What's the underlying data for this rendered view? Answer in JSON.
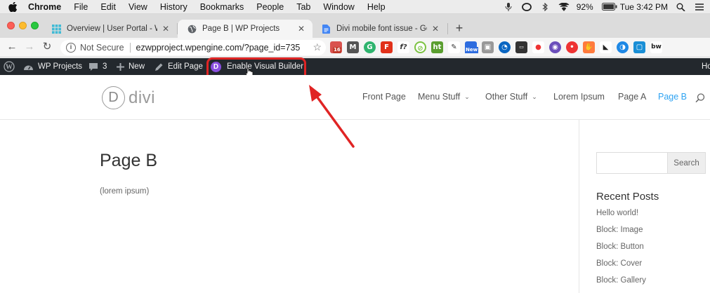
{
  "macos_menubar": {
    "app": "Chrome",
    "menus": [
      "File",
      "Edit",
      "View",
      "History",
      "Bookmarks",
      "People",
      "Tab",
      "Window",
      "Help"
    ],
    "battery": "92%",
    "clock": "Tue 3:42 PM"
  },
  "browser": {
    "tabs": [
      {
        "title": "Overview | User Portal - WP Engine",
        "favicon": "grid-icon",
        "active": false
      },
      {
        "title": "Page B | WP Projects",
        "favicon": "globe-icon",
        "active": true
      },
      {
        "title": "Divi mobile font issue - Google Docs",
        "favicon": "docs-icon",
        "active": false
      }
    ],
    "security_label": "Not Secure",
    "url": "ezwpproject.wpengine.com/?page_id=735",
    "extension_badges": {
      "ext1": "16",
      "ext6": "New"
    }
  },
  "wp_admin_bar": {
    "site_name": "WP Projects",
    "comments_count": "3",
    "new_label": "New",
    "edit_page_label": "Edit Page",
    "visual_builder_badge": "D",
    "visual_builder_label": "Enable Visual Builder",
    "howdy_truncated": "Ho"
  },
  "site_header": {
    "logo_letter": "D",
    "logo_word": "divi",
    "nav": [
      {
        "label": "Front Page",
        "has_submenu": false,
        "current": false
      },
      {
        "label": "Menu Stuff",
        "has_submenu": true,
        "current": false
      },
      {
        "label": "Other Stuff",
        "has_submenu": true,
        "current": false
      },
      {
        "label": "Lorem Ipsum",
        "has_submenu": false,
        "current": false
      },
      {
        "label": "Page A",
        "has_submenu": false,
        "current": false
      },
      {
        "label": "Page B",
        "has_submenu": false,
        "current": true
      }
    ]
  },
  "page": {
    "title": "Page B",
    "body": "(lorem ipsum)"
  },
  "sidebar": {
    "search_button": "Search",
    "recent_posts_title": "Recent Posts",
    "recent_posts": [
      "Hello world!",
      "Block: Image",
      "Block: Button",
      "Block: Cover",
      "Block: Gallery"
    ]
  },
  "colors": {
    "admin_bar_bg": "#23282d",
    "nav_current": "#2ea3f2",
    "annotation_red": "#e02424",
    "divi_purple": "#8a4fe0"
  }
}
